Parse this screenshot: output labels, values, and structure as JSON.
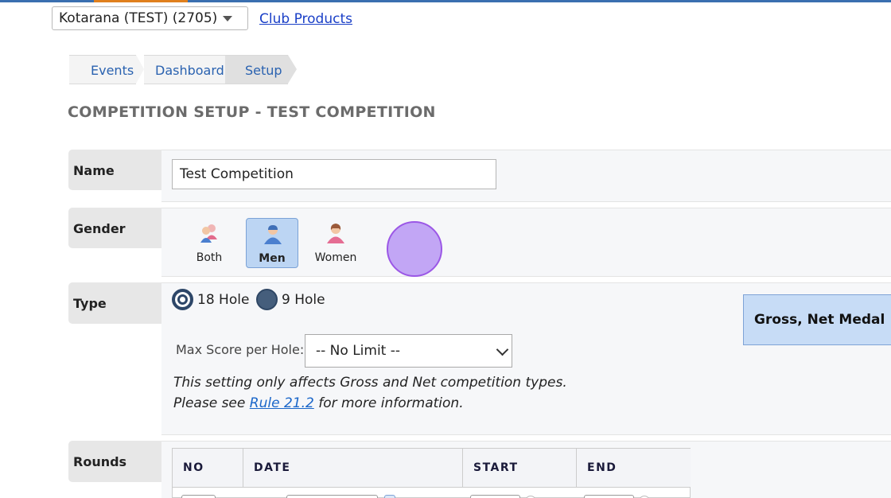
{
  "club": {
    "selected": "Kotarana (TEST) (2705)",
    "link": "Club Products"
  },
  "breadcrumbs": [
    "Events",
    "Dashboard",
    "Setup"
  ],
  "page_title": "COMPETITION SETUP - TEST COMPETITION",
  "name_row": {
    "label": "Name",
    "value": "Test Competition"
  },
  "gender_row": {
    "label": "Gender",
    "options": [
      {
        "label": "Both",
        "selected": false,
        "icon": "people-both-icon"
      },
      {
        "label": "Men",
        "selected": true,
        "icon": "person-male-icon"
      },
      {
        "label": "Women",
        "selected": false,
        "icon": "person-female-icon"
      }
    ]
  },
  "type_row": {
    "label": "Type",
    "radios": [
      {
        "label": "18 Hole",
        "checked": true
      },
      {
        "label": "9 Hole",
        "checked": false
      }
    ],
    "max_score_label": "Max Score per Hole:",
    "max_score_value": "-- No Limit --",
    "note_line1": "This setting only affects Gross and Net competition types.",
    "note_prefix": "Please see",
    "note_link": "Rule 21.2",
    "note_suffix": "for more information.",
    "competition_type": "Gross, Net Medal"
  },
  "rounds_row": {
    "label": "Rounds",
    "columns": [
      "NO",
      "DATE",
      "START",
      "END"
    ]
  },
  "colors": {
    "accent": "#3a6fb0",
    "selected_bg": "#bcd5f3",
    "link": "#1a66c9"
  }
}
